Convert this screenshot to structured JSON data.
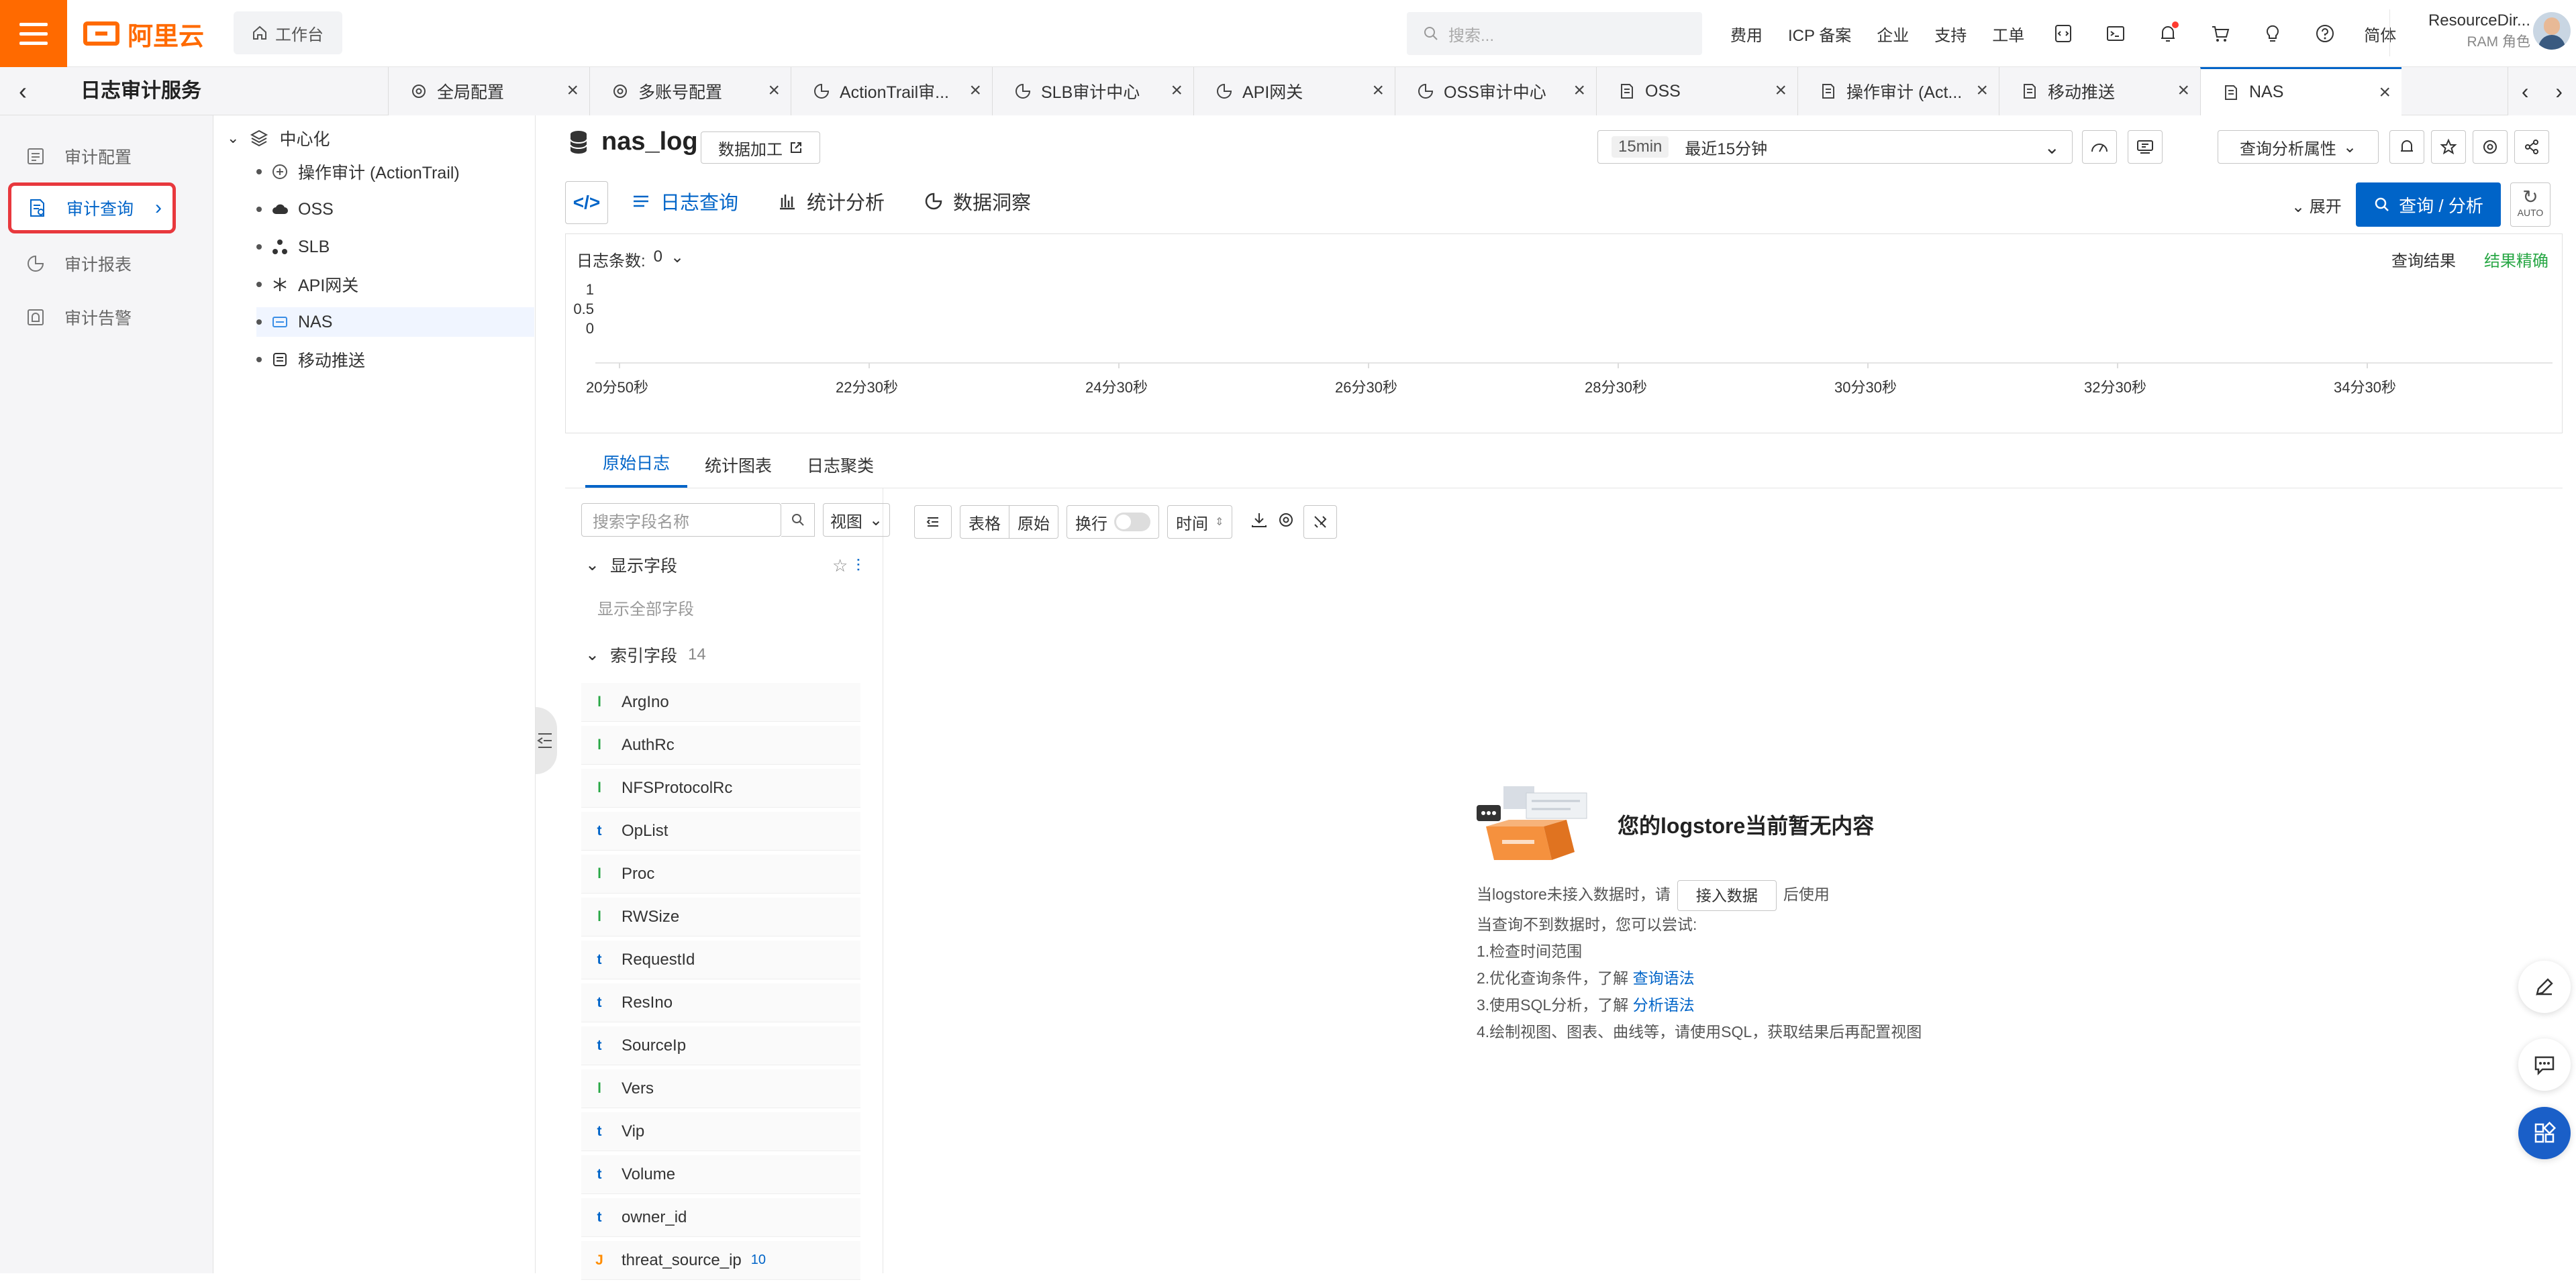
{
  "header": {
    "logo_text": "阿里云",
    "workbench_label": "工作台",
    "search_placeholder": "搜索...",
    "nav_items": [
      "费用",
      "ICP 备案",
      "企业",
      "支持",
      "工单"
    ],
    "lang_label": "简体",
    "account_name": "ResourceDir...",
    "account_role": "RAM 角色"
  },
  "tabbar": {
    "service_title": "日志审计服务",
    "tabs": [
      {
        "label": "全局配置",
        "icon": "gear-icon"
      },
      {
        "label": "多账号配置",
        "icon": "gear-icon"
      },
      {
        "label": "ActionTrail审...",
        "icon": "pie-icon"
      },
      {
        "label": "SLB审计中心",
        "icon": "pie-icon"
      },
      {
        "label": "API网关",
        "icon": "pie-icon"
      },
      {
        "label": "OSS审计中心",
        "icon": "pie-icon"
      },
      {
        "label": "OSS",
        "icon": "doc-icon"
      },
      {
        "label": "操作审计 (Act...",
        "icon": "doc-icon"
      },
      {
        "label": "移动推送",
        "icon": "doc-icon"
      },
      {
        "label": "NAS",
        "icon": "doc-icon",
        "active": true
      }
    ]
  },
  "leftnav": {
    "items": [
      {
        "label": "审计配置"
      },
      {
        "label": "审计查询",
        "active": true
      },
      {
        "label": "审计报表"
      },
      {
        "label": "审计告警"
      }
    ]
  },
  "tree": {
    "root_label": "中心化",
    "nodes": [
      {
        "label": "操作审计 (ActionTrail)"
      },
      {
        "label": "OSS"
      },
      {
        "label": "SLB"
      },
      {
        "label": "API网关"
      },
      {
        "label": "NAS",
        "selected": true
      },
      {
        "label": "移动推送"
      }
    ]
  },
  "logstore": {
    "name": "nas_log",
    "data_process_label": "数据加工",
    "time_quick": "15min",
    "time_label": "最近15分钟",
    "query_attr_label": "查询分析属性"
  },
  "query": {
    "tabs": [
      "日志查询",
      "统计分析",
      "数据洞察"
    ],
    "expand_label": "展开",
    "query_button": "查询 / 分析",
    "auto_label": "AUTO"
  },
  "chart": {
    "log_count_label": "日志条数:",
    "log_count": "0",
    "result_label": "查询结果",
    "result_status": "结果精确"
  },
  "chart_data": {
    "type": "bar",
    "ylim": [
      0,
      1
    ],
    "yticks": [
      "1",
      "0.5",
      "0"
    ],
    "x_labels": [
      "20分50秒",
      "22分30秒",
      "24分30秒",
      "26分30秒",
      "28分30秒",
      "30分30秒",
      "32分30秒",
      "34分30秒"
    ],
    "values": []
  },
  "subtabs": [
    "原始日志",
    "统计图表",
    "日志聚类"
  ],
  "fields": {
    "search_placeholder": "搜索字段名称",
    "view_label": "视图",
    "display_section": "显示字段",
    "show_all": "显示全部字段",
    "index_section": "索引字段",
    "index_count": "14",
    "list": [
      {
        "type": "l",
        "name": "ArgIno"
      },
      {
        "type": "l",
        "name": "AuthRc"
      },
      {
        "type": "l",
        "name": "NFSProtocolRc"
      },
      {
        "type": "t",
        "name": "OpList"
      },
      {
        "type": "l",
        "name": "Proc"
      },
      {
        "type": "l",
        "name": "RWSize"
      },
      {
        "type": "t",
        "name": "RequestId"
      },
      {
        "type": "t",
        "name": "ResIno"
      },
      {
        "type": "t",
        "name": "SourceIp"
      },
      {
        "type": "l",
        "name": "Vers"
      },
      {
        "type": "t",
        "name": "Vip"
      },
      {
        "type": "t",
        "name": "Volume"
      },
      {
        "type": "t",
        "name": "owner_id"
      },
      {
        "type": "J",
        "name": "threat_source_ip",
        "badge": "10"
      }
    ]
  },
  "rawtoolbar": {
    "table_label": "表格",
    "raw_label": "原始",
    "wrap_label": "换行",
    "time_label": "时间"
  },
  "empty": {
    "title": "您的logstore当前暂无内容",
    "line1_pre": "当logstore未接入数据时，请",
    "access_button": "接入数据",
    "line1_post": "后使用",
    "line2": "当查询不到数据时，您可以尝试:",
    "line3": "1.检查时间范围",
    "line4_pre": "2.优化查询条件，了解",
    "line4_link": "查询语法",
    "line5_pre": "3.使用SQL分析，了解",
    "line5_link": "分析语法",
    "line6": "4.绘制视图、图表、曲线等，请使用SQL，获取结果后再配置视图"
  },
  "colors": {
    "brand": "#ff6a00",
    "accent": "#0064c8",
    "success": "#28a745",
    "highlight_border": "#e8383d"
  }
}
